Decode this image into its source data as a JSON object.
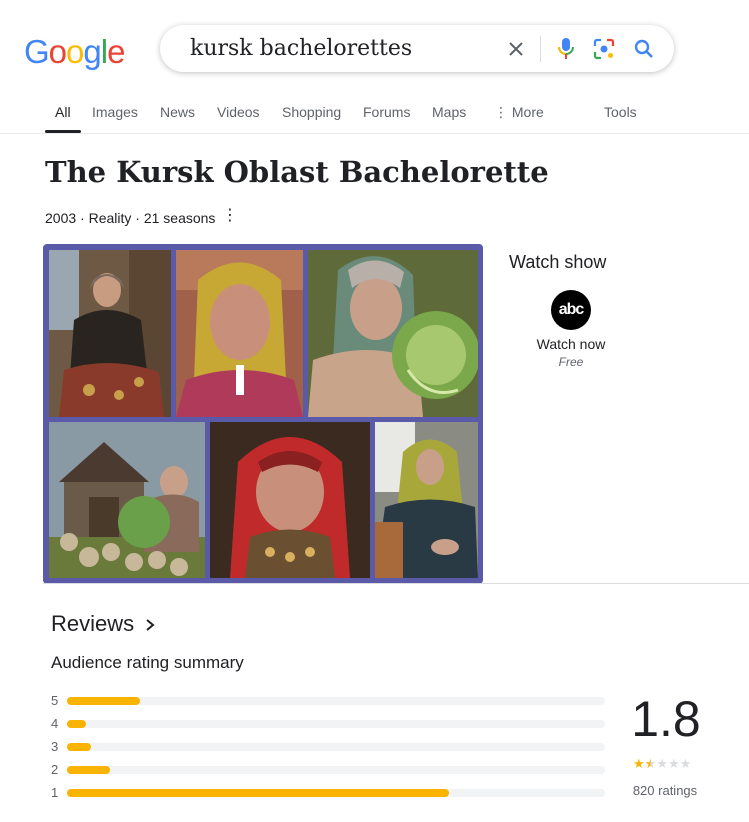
{
  "search": {
    "query": "kursk bachelorettes"
  },
  "logo": {
    "letters": [
      "G",
      "o",
      "o",
      "g",
      "l",
      "e"
    ],
    "colors": [
      "#4285F4",
      "#EA4335",
      "#FBBC05",
      "#4285F4",
      "#34A853",
      "#EA4335"
    ]
  },
  "tabs": [
    {
      "label": "All"
    },
    {
      "label": "Images"
    },
    {
      "label": "News"
    },
    {
      "label": "Videos"
    },
    {
      "label": "Shopping"
    },
    {
      "label": "Forums"
    },
    {
      "label": "Maps"
    },
    {
      "label": "⋮ More"
    },
    {
      "label": "Tools"
    }
  ],
  "show": {
    "title": "The Kursk Oblast Bachelorette",
    "meta": "2003 · Reality · 21 seasons"
  },
  "watch": {
    "heading": "Watch show",
    "provider_logo": "abc",
    "action": "Watch now",
    "price": "Free"
  },
  "reviews": {
    "heading": "Reviews",
    "summary_heading": "Audience rating summary",
    "rating": "1.8",
    "ratings_count": "820 ratings",
    "stars_value": 1.5,
    "distribution": [
      {
        "label": "5",
        "fraction": 0.135
      },
      {
        "label": "4",
        "fraction": 0.035
      },
      {
        "label": "3",
        "fraction": 0.045
      },
      {
        "label": "2",
        "fraction": 0.08
      },
      {
        "label": "1",
        "fraction": 0.71
      }
    ]
  },
  "colors": {
    "accent_yellow": "#f9b300",
    "grid_border": "#5a5aa8"
  },
  "icons": {
    "clear": "close-icon",
    "voice": "microphone-icon",
    "lens": "camera-lens-icon",
    "search": "search-icon",
    "more_options": "vertical-dots-icon",
    "chevron": "chevron-right-icon"
  }
}
